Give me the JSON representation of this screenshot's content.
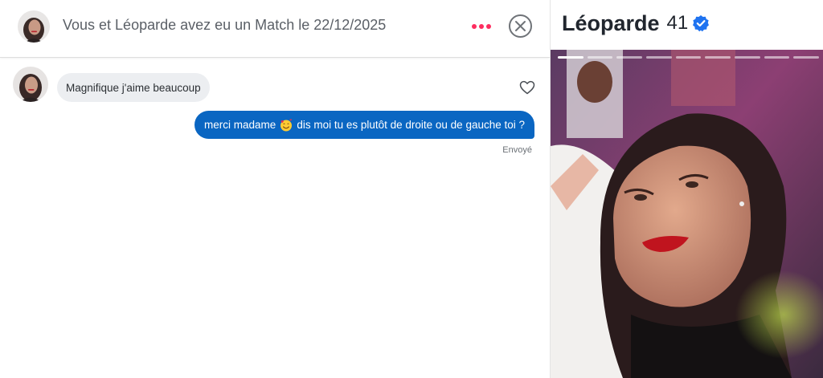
{
  "header": {
    "title": "Vous et Léoparde avez eu un Match le 22/12/2025",
    "more_icon": "more-dots-icon",
    "close_icon": "close-circle-icon",
    "accent_color": "#fd2d5f"
  },
  "messages": [
    {
      "direction": "incoming",
      "text": "Magnifique j'aime beaucoup",
      "like_icon": "heart-outline-icon"
    },
    {
      "direction": "outgoing",
      "text_before_emoji": "merci madame",
      "emoji": "smiling-face-with-hearts-icon",
      "text_after_emoji": "dis moi tu es plutôt de droite ou de gauche toi ?",
      "status": "Envoyé",
      "bubble_color": "#0a66c2"
    }
  ],
  "profile": {
    "name": "Léoparde",
    "age": "41",
    "verified_icon": "verified-badge-icon",
    "verified_color": "#1f73f0",
    "photo_count": 9,
    "active_photo": 1
  }
}
